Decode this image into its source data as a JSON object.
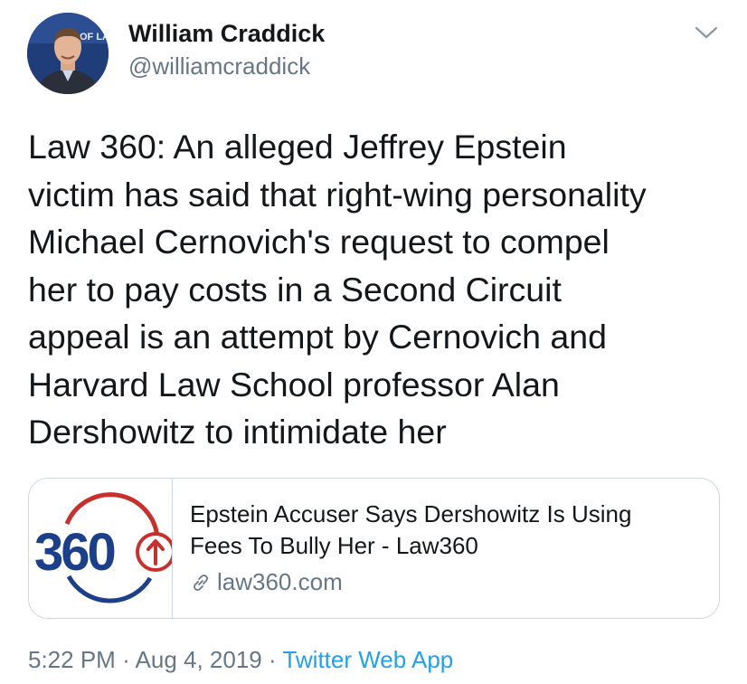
{
  "author": {
    "name": "William Craddick",
    "handle": "@williamcraddick",
    "avatar_banner_text": "OF LA"
  },
  "tweet": {
    "lines": [
      "Law 360: An alleged Jeffrey Epstein",
      "victim has said that right-wing personality",
      "Michael Cernovich's request to compel",
      "her to pay costs in a Second Circuit",
      "appeal is an attempt by Cernovich and",
      "Harvard Law School professor Alan",
      "Dershowitz to intimidate her"
    ]
  },
  "card": {
    "title_lines": [
      "Epstein Accuser Says Dershowitz Is Using",
      "Fees To Bully Her - Law360"
    ],
    "domain": "law360.com",
    "logo_text": "360"
  },
  "meta": {
    "time": "5:22 PM",
    "separator": "·",
    "date": "Aug 4, 2019",
    "app": "Twitter Web App"
  },
  "colors": {
    "text": "#14171a",
    "secondary": "#657786",
    "link": "#1da1f2",
    "border": "#ccd6dd",
    "law360_blue": "#1b3f8b",
    "law360_red": "#c8302c"
  },
  "icons": {
    "caret": "chevron-down-icon",
    "link": "link-icon"
  }
}
